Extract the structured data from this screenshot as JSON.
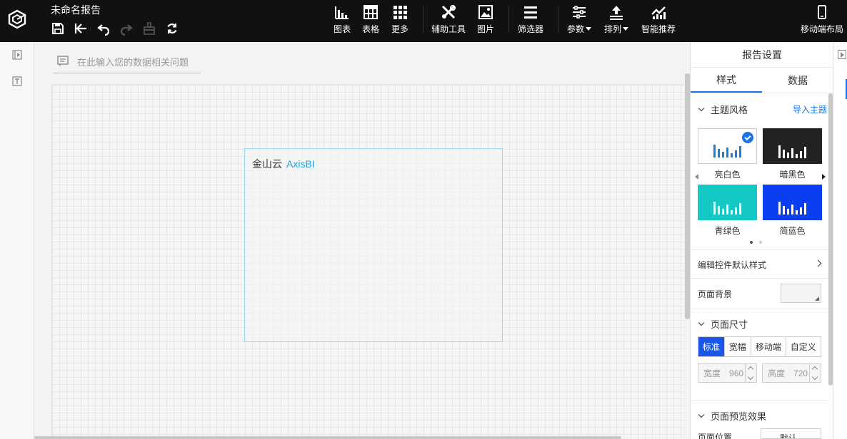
{
  "header": {
    "report_title": "未命名报告",
    "tools": [
      {
        "label": "图表"
      },
      {
        "label": "表格"
      },
      {
        "label": "更多"
      },
      {
        "label": "辅助工具"
      },
      {
        "label": "图片"
      },
      {
        "label": "筛选器"
      },
      {
        "label": "参数"
      },
      {
        "label": "排列"
      },
      {
        "label": "智能推荐"
      },
      {
        "label": "移动端布局"
      }
    ]
  },
  "canvas": {
    "query_placeholder": "在此输入您的数据相关问题",
    "widget_title_prefix": "金山云",
    "widget_title_brand": "AxisBI"
  },
  "panel": {
    "title": "报告设置",
    "tabs": [
      "样式",
      "数据"
    ],
    "theme_section": "主题风格",
    "import_theme": "导入主题",
    "themes": [
      {
        "label": "亮白色",
        "bg": "#ffffff",
        "bar": "#1a7fd6",
        "selected": true
      },
      {
        "label": "暗黑色",
        "bg": "#222222",
        "bar": "#ffffff",
        "selected": false
      },
      {
        "label": "青绿色",
        "bg": "#14c8c4",
        "bar": "#ffffff",
        "selected": false
      },
      {
        "label": "简蓝色",
        "bg": "#0a3ef0",
        "bar": "#ffffff",
        "selected": false
      }
    ],
    "edit_default_style": "编辑控件默认样式",
    "page_background": "页面背景",
    "page_size_section": "页面尺寸",
    "size_options": [
      "标准",
      "宽幅",
      "移动端",
      "自定义"
    ],
    "width_label": "宽度",
    "width_value": "960",
    "height_label": "高度",
    "height_value": "720",
    "preview_section": "页面预览效果",
    "page_position_label": "页面位置",
    "page_position_value": "默认"
  }
}
